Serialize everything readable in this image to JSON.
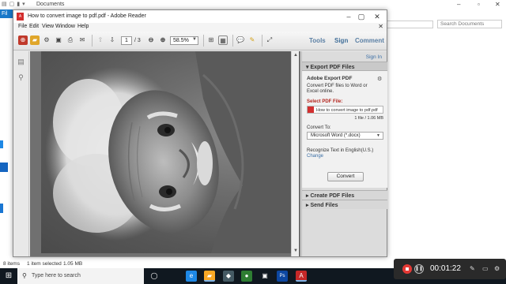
{
  "explorer": {
    "title": "Documents",
    "file_tab": "Fil",
    "search_placeholder": "Search Documents",
    "status_items": "8 items",
    "status_selected": "1 item selected",
    "status_size": "1.05 MB"
  },
  "acrobat": {
    "title": "How to convert image to pdf.pdf - Adobe Reader",
    "menus": [
      "File",
      "Edit",
      "View",
      "Window",
      "Help"
    ],
    "toolbar": {
      "page_current": "1",
      "page_total": "/ 3",
      "zoom": "58.5%",
      "tools_link": "Tools",
      "sign_link": "Sign",
      "comment_link": "Comment"
    },
    "tools_pane": {
      "signin": "Sign In",
      "export_header": "Export PDF Files",
      "export_title": "Adobe Export PDF",
      "export_desc": "Convert PDF files to Word or Excel online.",
      "select_label": "Select PDF File:",
      "file_name": "How to convert image to pdf.pdf",
      "file_count": "1 file / 1.06 MB",
      "convert_to_label": "Convert To:",
      "convert_to_value": "Microsoft Word (*.docx)",
      "recognize_text": "Recognize Text in English(U.S.)",
      "change_link": "Change",
      "convert_button": "Convert",
      "create_header": "Create PDF Files",
      "send_header": "Send Files"
    }
  },
  "taskbar": {
    "search_placeholder": "Type here to search",
    "apps": [
      {
        "name": "task-view",
        "color": "#101820",
        "glyph": "O"
      },
      {
        "name": "edge",
        "color": "#1e88e5",
        "glyph": "e"
      },
      {
        "name": "file-explorer",
        "color": "#f9a825",
        "glyph": "▰"
      },
      {
        "name": "store",
        "color": "#455a64",
        "glyph": "◆"
      },
      {
        "name": "chrome",
        "color": "#43a047",
        "glyph": "●"
      },
      {
        "name": "photoshop",
        "color": "#0d47a1",
        "glyph": "Ps"
      },
      {
        "name": "acrobat",
        "color": "#c62828",
        "glyph": "A"
      }
    ]
  },
  "recorder": {
    "elapsed": "00:01:22"
  }
}
